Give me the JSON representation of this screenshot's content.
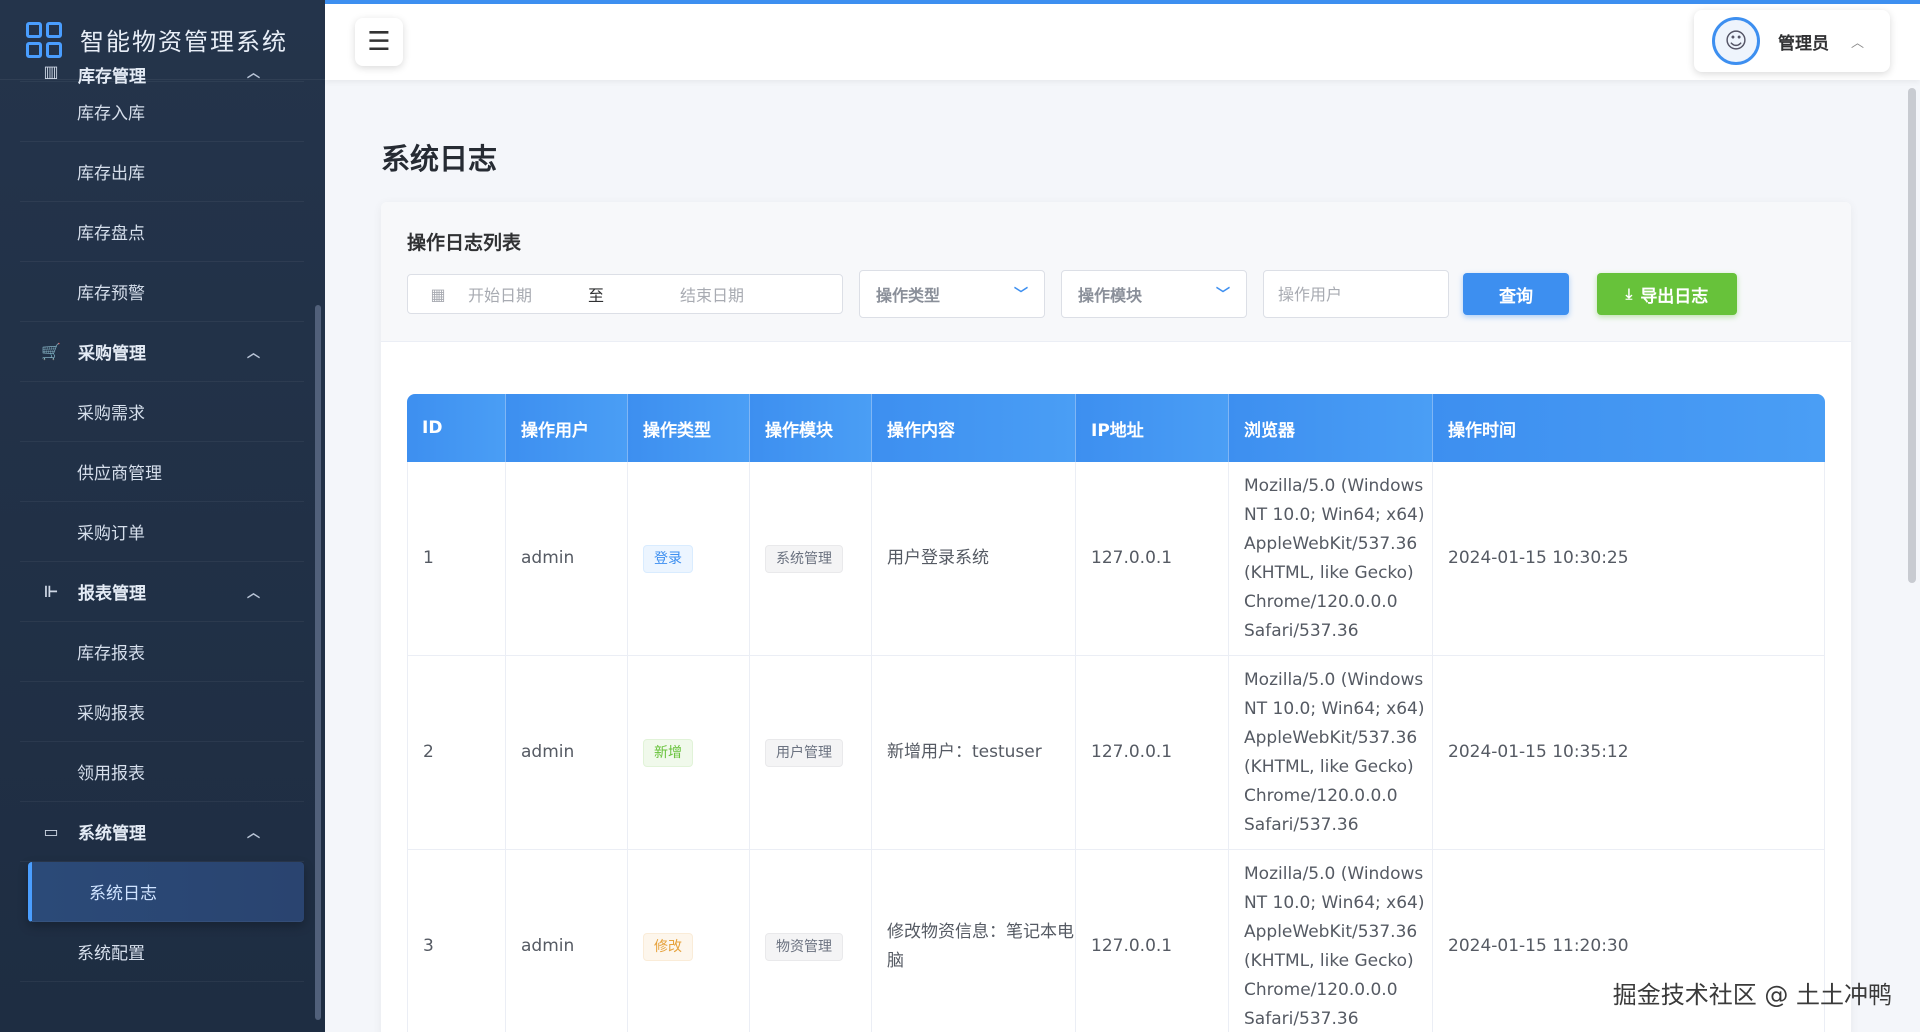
{
  "app": {
    "title": "智能物资管理系统"
  },
  "sidebar": {
    "groups": [
      {
        "label": "库存管理",
        "icon": "inventory-icon",
        "items": [
          "库存入库",
          "库存出库",
          "库存盘点",
          "库存预警"
        ]
      },
      {
        "label": "采购管理",
        "icon": "cart-icon",
        "items": [
          "采购需求",
          "供应商管理",
          "采购订单"
        ]
      },
      {
        "label": "报表管理",
        "icon": "chart-icon",
        "items": [
          "库存报表",
          "采购报表",
          "领用报表"
        ]
      },
      {
        "label": "系统管理",
        "icon": "monitor-icon",
        "items": [
          "系统日志",
          "系统配置"
        ]
      }
    ],
    "active_item": "系统日志"
  },
  "header": {
    "user_name": "管理员"
  },
  "page": {
    "title": "系统日志"
  },
  "card": {
    "title": "操作日志列表",
    "filters": {
      "start_placeholder": "开始日期",
      "range_sep": "至",
      "end_placeholder": "结束日期",
      "type_placeholder": "操作类型",
      "module_placeholder": "操作模块",
      "user_placeholder": "操作用户",
      "query_label": "查询",
      "export_label": "导出日志"
    }
  },
  "table": {
    "columns": [
      "ID",
      "操作用户",
      "操作类型",
      "操作模块",
      "操作内容",
      "IP地址",
      "浏览器",
      "操作时间"
    ],
    "rows": [
      {
        "id": "1",
        "user": "admin",
        "type": "登录",
        "type_color": "blue",
        "module": "系统管理",
        "content": "用户登录系统",
        "ip": "127.0.0.1",
        "browser": "Mozilla/5.0 (Windows NT 10.0; Win64; x64) AppleWebKit/537.36 (KHTML, like Gecko) Chrome/120.0.0.0 Safari/537.36",
        "time": "2024-01-15 10:30:25"
      },
      {
        "id": "2",
        "user": "admin",
        "type": "新增",
        "type_color": "green",
        "module": "用户管理",
        "content": "新增用户：testuser",
        "ip": "127.0.0.1",
        "browser": "Mozilla/5.0 (Windows NT 10.0; Win64; x64) AppleWebKit/537.36 (KHTML, like Gecko) Chrome/120.0.0.0 Safari/537.36",
        "time": "2024-01-15 10:35:12"
      },
      {
        "id": "3",
        "user": "admin",
        "type": "修改",
        "type_color": "orange",
        "module": "物资管理",
        "content": "修改物资信息：笔记本电脑",
        "ip": "127.0.0.1",
        "browser": "Mozilla/5.0 (Windows NT 10.0; Win64; x64) AppleWebKit/537.36 (KHTML, like Gecko) Chrome/120.0.0.0 Safari/537.36",
        "time": "2024-01-15 11:20:30"
      }
    ]
  },
  "watermark": "掘金技术社区 @ 土土冲鸭",
  "colors": {
    "primary": "#3d8ff0",
    "success": "#67c23a",
    "warning": "#e6a23c",
    "sidebar_bg": "#24344b"
  }
}
